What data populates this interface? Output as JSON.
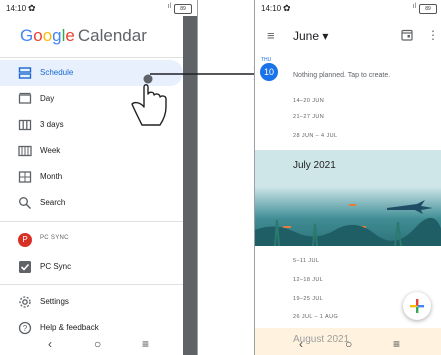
{
  "left": {
    "status": {
      "time": "14:10",
      "battery": "89"
    },
    "logo": {
      "g1": "G",
      "g2": "o",
      "g3": "o",
      "g4": "g",
      "g5": "l",
      "g6": "e",
      "product": "Calendar"
    },
    "nav": [
      {
        "label": "Schedule",
        "icon": "schedule-icon",
        "active": true
      },
      {
        "label": "Day",
        "icon": "day-icon"
      },
      {
        "label": "3 days",
        "icon": "three-days-icon"
      },
      {
        "label": "Week",
        "icon": "week-icon"
      },
      {
        "label": "Month",
        "icon": "month-icon"
      },
      {
        "label": "Search",
        "icon": "search-icon"
      }
    ],
    "account": {
      "initial": "P",
      "label": "PC SYNC"
    },
    "calendar_item": {
      "label": "PC Sync",
      "icon": "checkbox-checked-icon"
    },
    "footer": [
      {
        "label": "Settings",
        "icon": "settings-icon"
      },
      {
        "label": "Help & feedback",
        "icon": "help-icon"
      }
    ],
    "navbar": {
      "back": "‹",
      "home": "○",
      "recents": "≡"
    }
  },
  "right": {
    "status": {
      "time": "14:10",
      "battery": "89"
    },
    "topbar": {
      "month": "June ▾",
      "menu_icon": "menu-icon",
      "today_icon": "calendar-today-icon",
      "overflow_icon": "more-vert-icon"
    },
    "today": {
      "weekday": "THU",
      "date": "10",
      "empty_text": "Nothing planned. Tap to create."
    },
    "weeks_june": [
      "14–20 JUN",
      "21–27 JUN",
      "28 JUN – 4 JUL"
    ],
    "month_banner": "July 2021",
    "weeks_july": [
      "5–11 JUL",
      "12–18 JUL",
      "19–25 JUL",
      "26 JUL – 1 AUG"
    ],
    "next_banner": "August 2021",
    "fab": "+",
    "navbar": {
      "back": "‹",
      "home": "○",
      "recents": "≡"
    }
  }
}
